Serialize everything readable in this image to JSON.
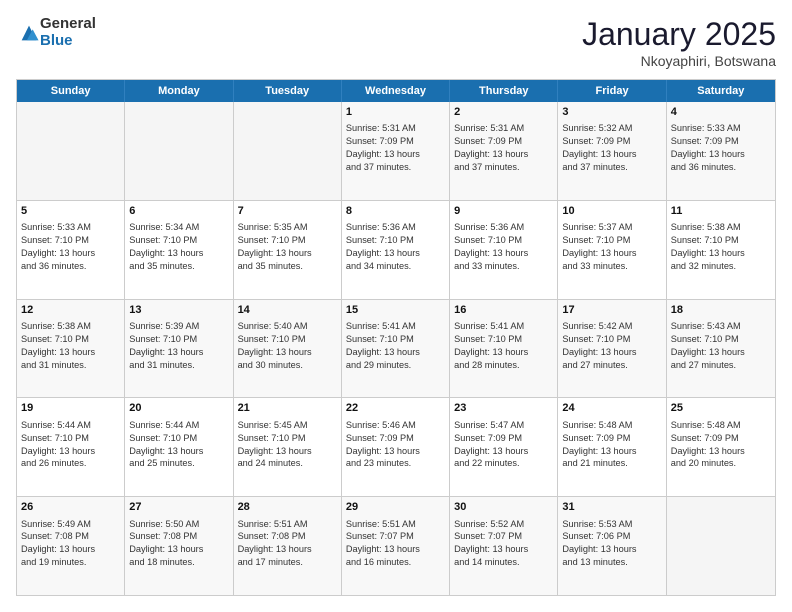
{
  "logo": {
    "general": "General",
    "blue": "Blue"
  },
  "header": {
    "month": "January 2025",
    "location": "Nkoyaphiri, Botswana"
  },
  "weekdays": [
    "Sunday",
    "Monday",
    "Tuesday",
    "Wednesday",
    "Thursday",
    "Friday",
    "Saturday"
  ],
  "rows": [
    [
      {
        "day": "",
        "info": "",
        "empty": true
      },
      {
        "day": "",
        "info": "",
        "empty": true
      },
      {
        "day": "",
        "info": "",
        "empty": true
      },
      {
        "day": "1",
        "info": "Sunrise: 5:31 AM\nSunset: 7:09 PM\nDaylight: 13 hours\nand 37 minutes."
      },
      {
        "day": "2",
        "info": "Sunrise: 5:31 AM\nSunset: 7:09 PM\nDaylight: 13 hours\nand 37 minutes."
      },
      {
        "day": "3",
        "info": "Sunrise: 5:32 AM\nSunset: 7:09 PM\nDaylight: 13 hours\nand 37 minutes."
      },
      {
        "day": "4",
        "info": "Sunrise: 5:33 AM\nSunset: 7:09 PM\nDaylight: 13 hours\nand 36 minutes."
      }
    ],
    [
      {
        "day": "5",
        "info": "Sunrise: 5:33 AM\nSunset: 7:10 PM\nDaylight: 13 hours\nand 36 minutes."
      },
      {
        "day": "6",
        "info": "Sunrise: 5:34 AM\nSunset: 7:10 PM\nDaylight: 13 hours\nand 35 minutes."
      },
      {
        "day": "7",
        "info": "Sunrise: 5:35 AM\nSunset: 7:10 PM\nDaylight: 13 hours\nand 35 minutes."
      },
      {
        "day": "8",
        "info": "Sunrise: 5:36 AM\nSunset: 7:10 PM\nDaylight: 13 hours\nand 34 minutes."
      },
      {
        "day": "9",
        "info": "Sunrise: 5:36 AM\nSunset: 7:10 PM\nDaylight: 13 hours\nand 33 minutes."
      },
      {
        "day": "10",
        "info": "Sunrise: 5:37 AM\nSunset: 7:10 PM\nDaylight: 13 hours\nand 33 minutes."
      },
      {
        "day": "11",
        "info": "Sunrise: 5:38 AM\nSunset: 7:10 PM\nDaylight: 13 hours\nand 32 minutes."
      }
    ],
    [
      {
        "day": "12",
        "info": "Sunrise: 5:38 AM\nSunset: 7:10 PM\nDaylight: 13 hours\nand 31 minutes."
      },
      {
        "day": "13",
        "info": "Sunrise: 5:39 AM\nSunset: 7:10 PM\nDaylight: 13 hours\nand 31 minutes."
      },
      {
        "day": "14",
        "info": "Sunrise: 5:40 AM\nSunset: 7:10 PM\nDaylight: 13 hours\nand 30 minutes."
      },
      {
        "day": "15",
        "info": "Sunrise: 5:41 AM\nSunset: 7:10 PM\nDaylight: 13 hours\nand 29 minutes."
      },
      {
        "day": "16",
        "info": "Sunrise: 5:41 AM\nSunset: 7:10 PM\nDaylight: 13 hours\nand 28 minutes."
      },
      {
        "day": "17",
        "info": "Sunrise: 5:42 AM\nSunset: 7:10 PM\nDaylight: 13 hours\nand 27 minutes."
      },
      {
        "day": "18",
        "info": "Sunrise: 5:43 AM\nSunset: 7:10 PM\nDaylight: 13 hours\nand 27 minutes."
      }
    ],
    [
      {
        "day": "19",
        "info": "Sunrise: 5:44 AM\nSunset: 7:10 PM\nDaylight: 13 hours\nand 26 minutes."
      },
      {
        "day": "20",
        "info": "Sunrise: 5:44 AM\nSunset: 7:10 PM\nDaylight: 13 hours\nand 25 minutes."
      },
      {
        "day": "21",
        "info": "Sunrise: 5:45 AM\nSunset: 7:10 PM\nDaylight: 13 hours\nand 24 minutes."
      },
      {
        "day": "22",
        "info": "Sunrise: 5:46 AM\nSunset: 7:09 PM\nDaylight: 13 hours\nand 23 minutes."
      },
      {
        "day": "23",
        "info": "Sunrise: 5:47 AM\nSunset: 7:09 PM\nDaylight: 13 hours\nand 22 minutes."
      },
      {
        "day": "24",
        "info": "Sunrise: 5:48 AM\nSunset: 7:09 PM\nDaylight: 13 hours\nand 21 minutes."
      },
      {
        "day": "25",
        "info": "Sunrise: 5:48 AM\nSunset: 7:09 PM\nDaylight: 13 hours\nand 20 minutes."
      }
    ],
    [
      {
        "day": "26",
        "info": "Sunrise: 5:49 AM\nSunset: 7:08 PM\nDaylight: 13 hours\nand 19 minutes."
      },
      {
        "day": "27",
        "info": "Sunrise: 5:50 AM\nSunset: 7:08 PM\nDaylight: 13 hours\nand 18 minutes."
      },
      {
        "day": "28",
        "info": "Sunrise: 5:51 AM\nSunset: 7:08 PM\nDaylight: 13 hours\nand 17 minutes."
      },
      {
        "day": "29",
        "info": "Sunrise: 5:51 AM\nSunset: 7:07 PM\nDaylight: 13 hours\nand 16 minutes."
      },
      {
        "day": "30",
        "info": "Sunrise: 5:52 AM\nSunset: 7:07 PM\nDaylight: 13 hours\nand 14 minutes."
      },
      {
        "day": "31",
        "info": "Sunrise: 5:53 AM\nSunset: 7:06 PM\nDaylight: 13 hours\nand 13 minutes."
      },
      {
        "day": "",
        "info": "",
        "empty": true
      }
    ]
  ]
}
